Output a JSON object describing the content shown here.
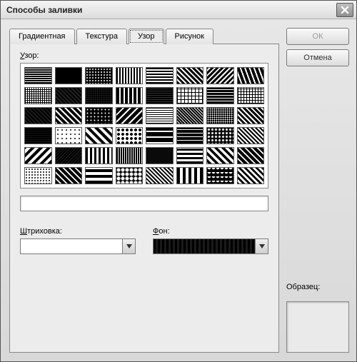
{
  "window": {
    "title": "Способы заливки"
  },
  "tabs": [
    {
      "label": "Градиентная",
      "active": false
    },
    {
      "label": "Текстура",
      "active": false
    },
    {
      "label": "Узор",
      "active": true
    },
    {
      "label": "Рисунок",
      "active": false
    }
  ],
  "panel": {
    "pattern_label": "Узор:",
    "pattern_label_ul": "У",
    "pattern_label_rest": "зор:",
    "name_value": "",
    "hatch_label": "Штриховка:",
    "hatch_label_ul": "Ш",
    "hatch_label_rest": "триховка:",
    "hatch_value": "",
    "bg_label": "Фон:",
    "bg_label_ul": "Ф",
    "bg_label_rest": "он:",
    "bg_value_color": "#000000"
  },
  "buttons": {
    "ok": "ОК",
    "cancel": "Отмена"
  },
  "sample": {
    "label": "Образец:"
  },
  "patterns": {
    "rows": 6,
    "cols": 8,
    "count": 48
  }
}
